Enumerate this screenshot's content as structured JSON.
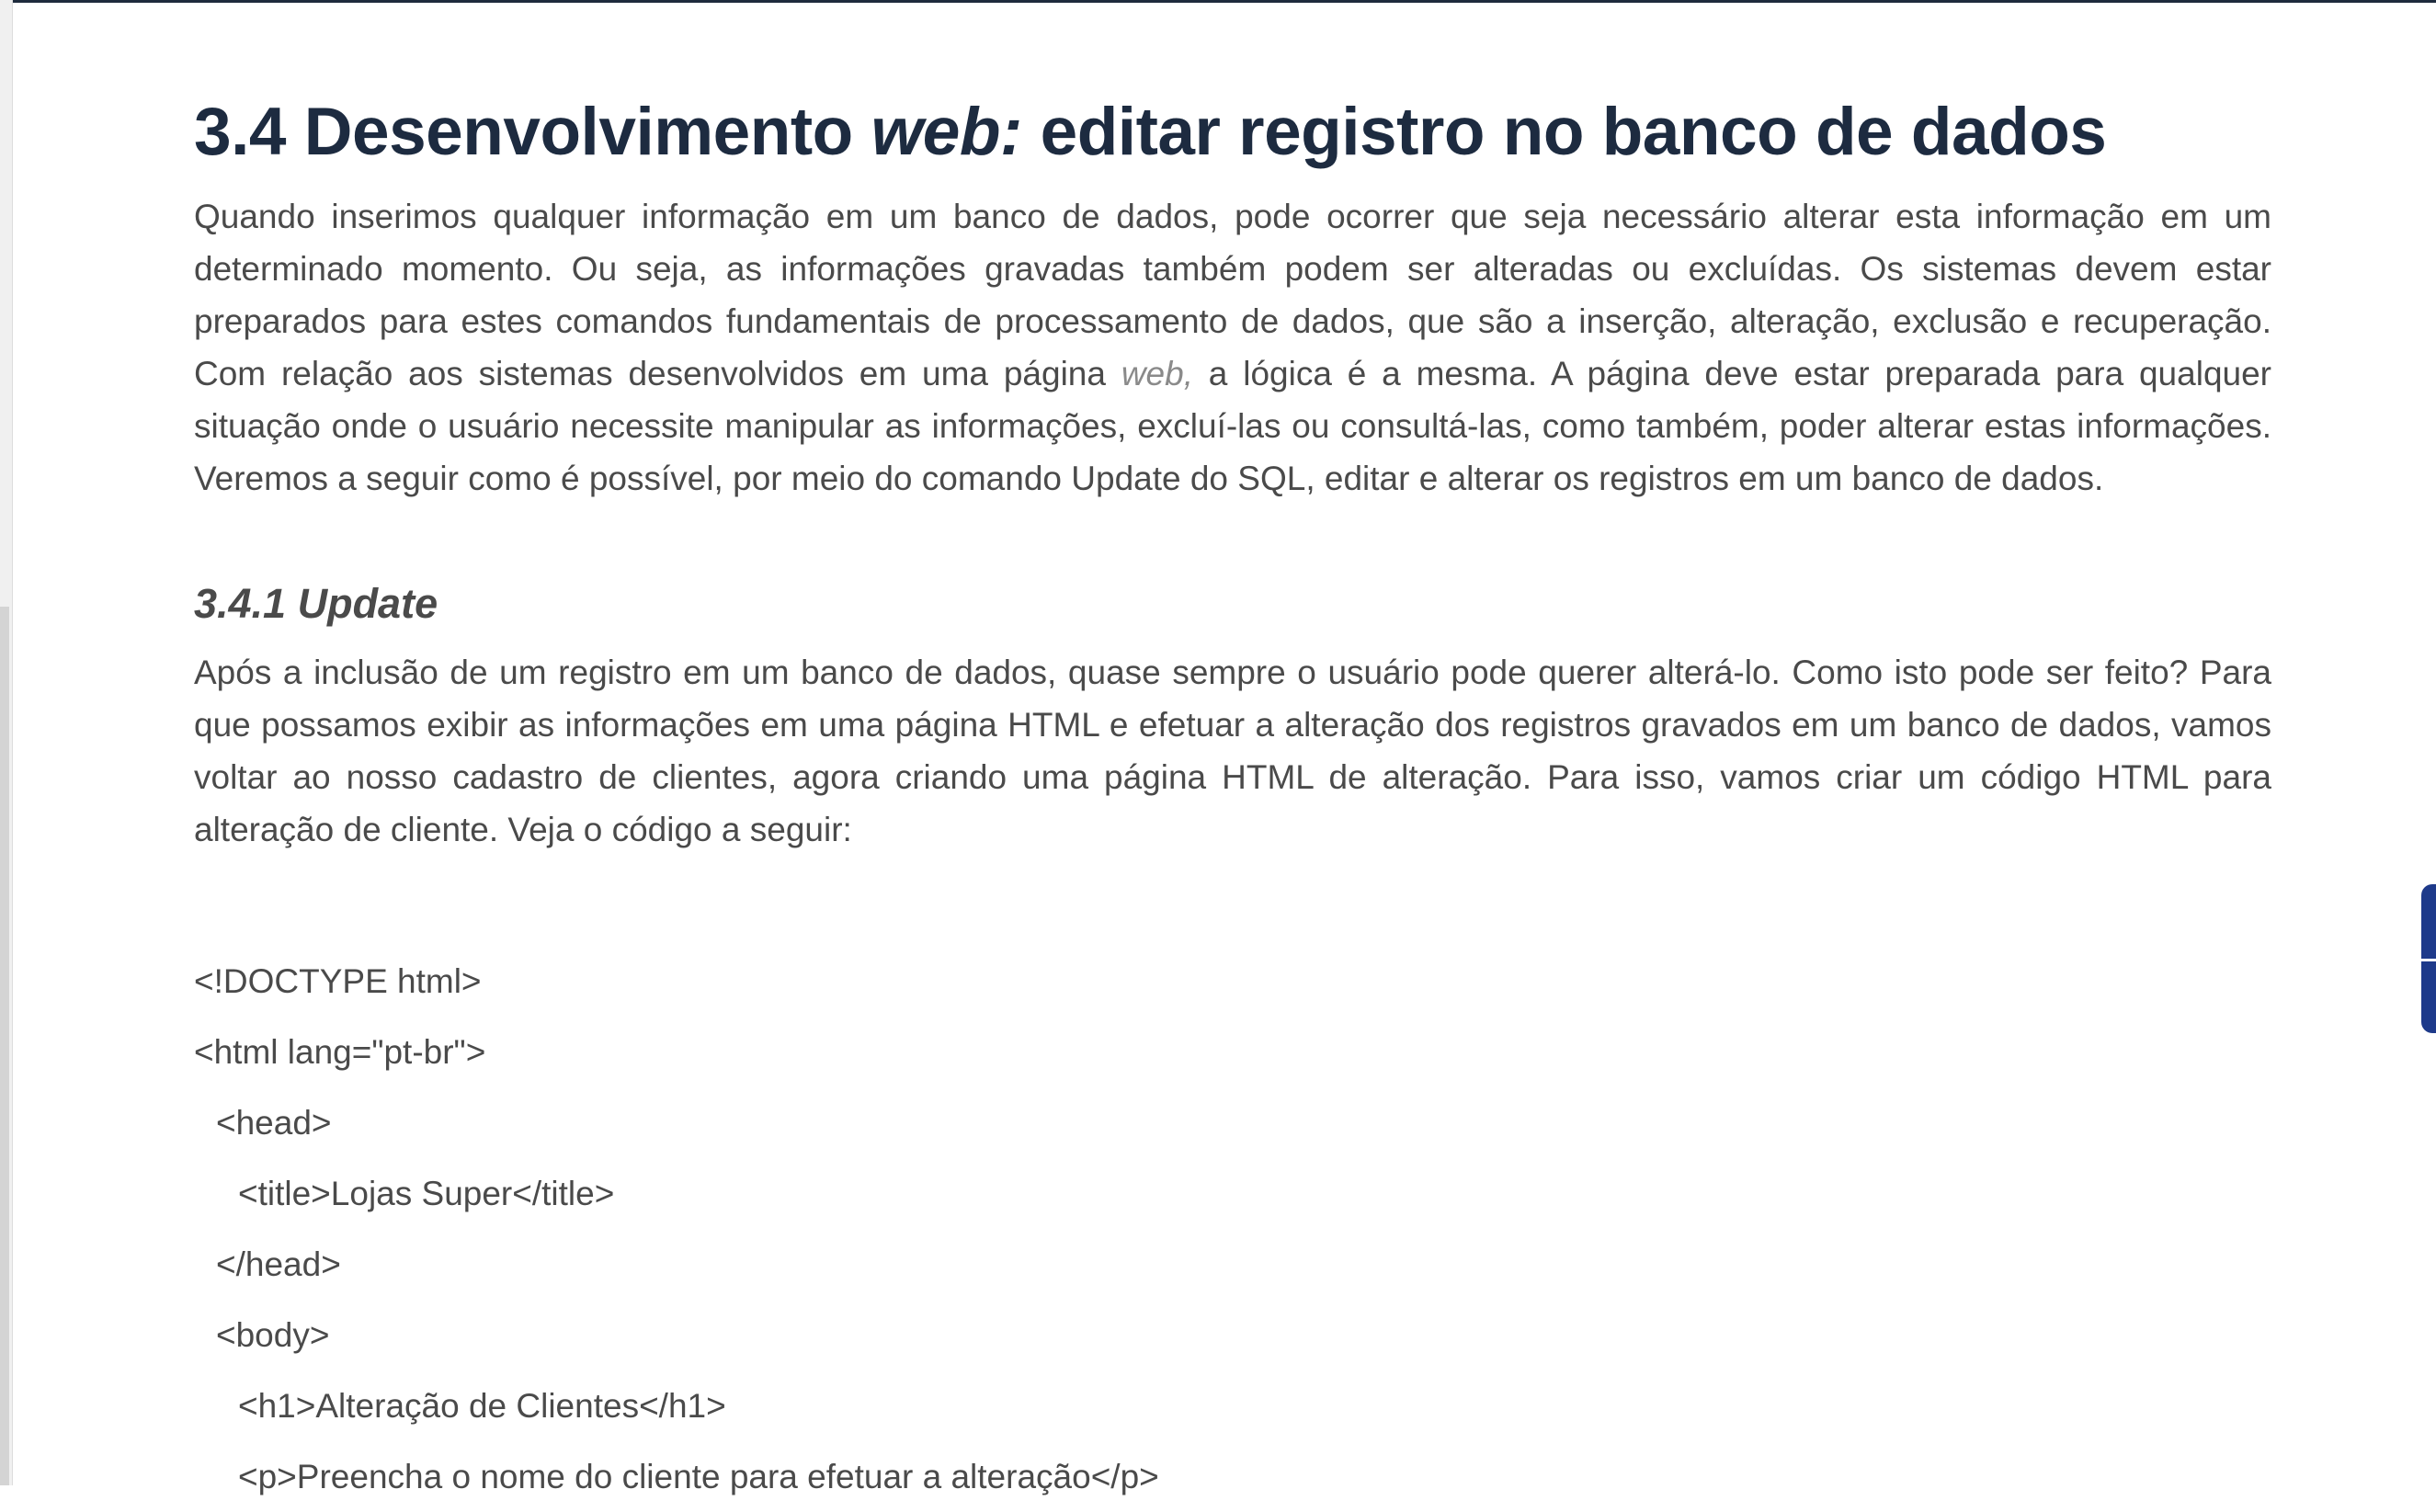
{
  "title": {
    "number": "3.4 Desenvolvimento ",
    "italic": "web:",
    "rest": " editar registro no banco de dados"
  },
  "intro": {
    "before_web": "Quando inserimos qualquer informação em um banco de dados, pode ocorrer que seja necessário alterar esta informação em um determinado momento. Ou seja, as informações gravadas também podem ser alteradas ou excluídas. Os sistemas devem estar preparados para estes comandos fundamentais de processamento de dados, que são a inserção, alteração, exclusão e recuperação. Com relação aos sistemas desenvolvidos em uma página ",
    "web": "web,",
    "after_web": " a lógica é a mesma. A página deve estar preparada para qualquer situação onde o usuário necessite manipular as informações, excluí-las ou consultá-las, como também, poder alterar estas informações. Veremos a seguir como é possível, por meio do comando Update do SQL, editar e alterar os registros em um banco de dados."
  },
  "section": {
    "title": "3.4.1 Update",
    "paragraph": "Após a inclusão de um registro em um banco de dados, quase sempre o usuário pode querer alterá-lo. Como isto pode ser feito? Para que possamos exibir as informações em uma página HTML e efetuar a alteração dos registros gravados em um banco de dados, vamos voltar ao nosso cadastro de clientes, agora criando uma página HTML de alteração. Para isso, vamos criar um código HTML para alteração de cliente. Veja o código a seguir:"
  },
  "code_lines": [
    "<!DOCTYPE html>",
    "<html lang=\"pt-br\">",
    "<head>",
    "<title>Lojas Super</title>",
    "</head>",
    "<body>",
    "<h1>Alteração de Clientes</h1>",
    "<p>Preencha o nome do cliente para efetuar a alteração</p>"
  ],
  "colors": {
    "heading": "#1d2b40",
    "body_text": "#4a4a4a",
    "side_tab": "#1e3a8a"
  }
}
